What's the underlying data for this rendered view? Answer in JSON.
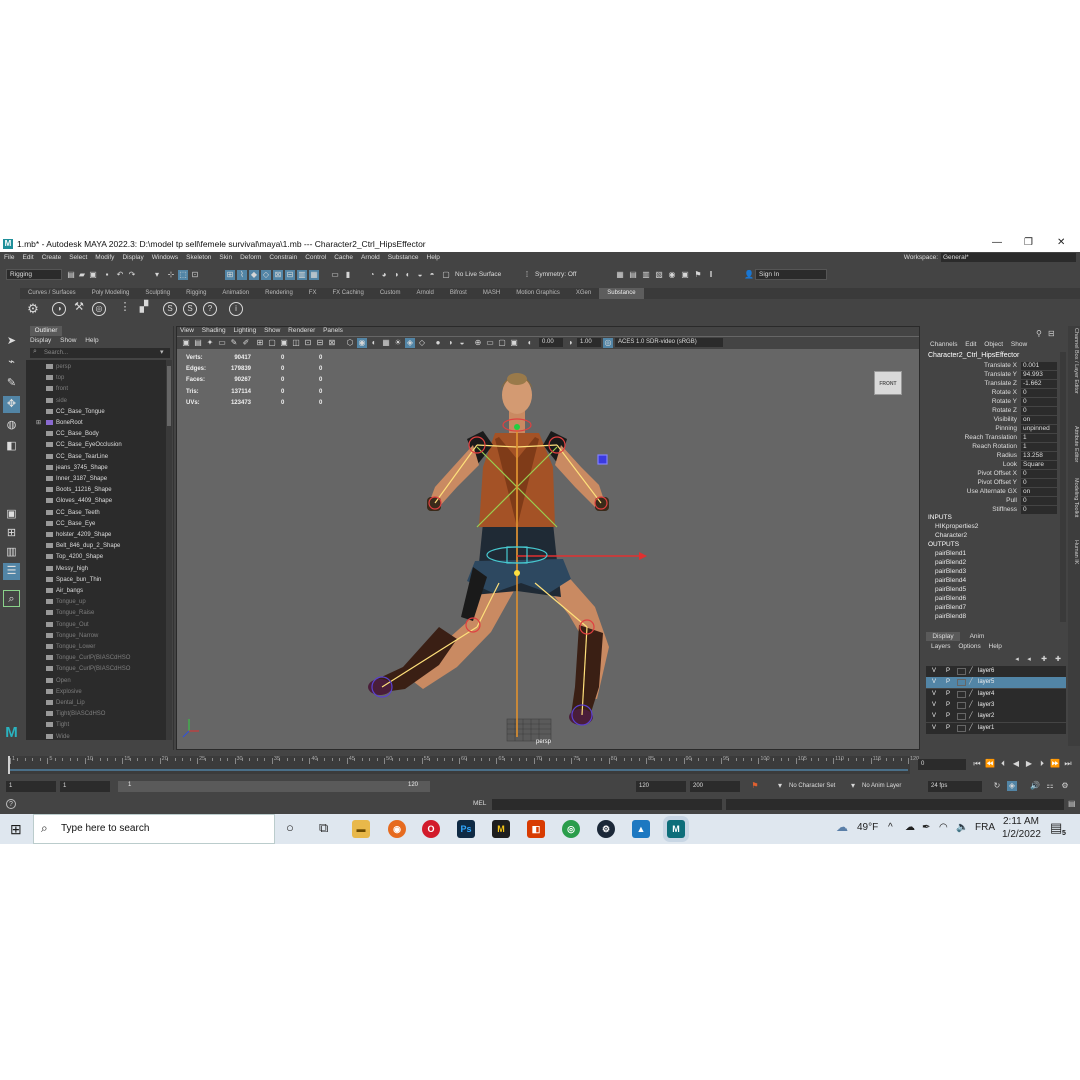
{
  "titlebar": {
    "logo": "M",
    "title": "1.mb* - Autodesk MAYA 2022.3: D:\\model tp sell\\femele survival\\maya\\1.mb   ---   Character2_Ctrl_HipsEffector",
    "controls": [
      "—",
      "❐",
      "✕"
    ]
  },
  "menubar": {
    "items": [
      "File",
      "Edit",
      "Create",
      "Select",
      "Modify",
      "Display",
      "Windows",
      "Skeleton",
      "Skin",
      "Deform",
      "Constrain",
      "Control",
      "Cache",
      "Arnold",
      "Substance",
      "Help"
    ],
    "workspace_label": "Workspace:",
    "workspace_value": "General*"
  },
  "statusline": {
    "menuset": "Rigging",
    "live_surface": "No Live Surface",
    "symmetry": "Symmetry: Off",
    "sign_in": "Sign In"
  },
  "shelf": {
    "tabs": [
      "Curves / Surfaces",
      "Poly Modeling",
      "Sculpting",
      "Rigging",
      "Animation",
      "Rendering",
      "FX",
      "FX Caching",
      "Custom",
      "Arnold",
      "Bifrost",
      "MASH",
      "Motion Graphics",
      "XGen",
      "Substance"
    ],
    "active_tab": "Substance"
  },
  "outliner": {
    "tab": "Outliner",
    "menu": [
      "Display",
      "Show",
      "Help"
    ],
    "search_placeholder": "Search...",
    "items": [
      {
        "label": "persp",
        "dim": true
      },
      {
        "label": "top",
        "dim": true
      },
      {
        "label": "front",
        "dim": true
      },
      {
        "label": "side",
        "dim": true
      },
      {
        "label": "CC_Base_Tongue",
        "dim": false
      },
      {
        "label": "BoneRoot",
        "dim": false,
        "joint": true
      },
      {
        "label": "CC_Base_Body",
        "dim": false
      },
      {
        "label": "CC_Base_EyeOcclusion",
        "dim": false
      },
      {
        "label": "CC_Base_TearLine",
        "dim": false
      },
      {
        "label": "jeans_3745_Shape",
        "dim": false
      },
      {
        "label": "Inner_3187_Shape",
        "dim": false
      },
      {
        "label": "Boots_11216_Shape",
        "dim": false
      },
      {
        "label": "Gloves_4409_Shape",
        "dim": false
      },
      {
        "label": "CC_Base_Teeth",
        "dim": false
      },
      {
        "label": "CC_Base_Eye",
        "dim": false
      },
      {
        "label": "holster_4209_Shape",
        "dim": false
      },
      {
        "label": "Belt_846_dup_2_Shape",
        "dim": false
      },
      {
        "label": "Top_4200_Shape",
        "dim": false
      },
      {
        "label": "Messy_high",
        "dim": false
      },
      {
        "label": "Space_bun_Thin",
        "dim": false
      },
      {
        "label": "Air_bangs",
        "dim": false
      },
      {
        "label": "Tongue_up",
        "dim": true
      },
      {
        "label": "Tongue_Raise",
        "dim": true
      },
      {
        "label": "Tongue_Out",
        "dim": true
      },
      {
        "label": "Tongue_Narrow",
        "dim": true
      },
      {
        "label": "Tongue_Lower",
        "dim": true
      },
      {
        "label": "Tongue_CurlP(BIASCdHSO",
        "dim": true
      },
      {
        "label": "Tongue_CurlP(BIASCdHSO",
        "dim": true
      },
      {
        "label": "Open",
        "dim": true
      },
      {
        "label": "Explosive",
        "dim": true
      },
      {
        "label": "Dental_Lip",
        "dim": true
      },
      {
        "label": "Tight(BIASCdHSO",
        "dim": true
      },
      {
        "label": "Tight",
        "dim": true
      },
      {
        "label": "Wide",
        "dim": true
      }
    ]
  },
  "viewport": {
    "menu": [
      "View",
      "Shading",
      "Lighting",
      "Show",
      "Renderer",
      "Panels"
    ],
    "exposure": "0.00",
    "gamma": "1.00",
    "color_space": "ACES 1.0 SDR-video (sRGB)",
    "hud": [
      {
        "label": "Verts:",
        "v1": "90417",
        "v2": "0",
        "v3": "0"
      },
      {
        "label": "Edges:",
        "v1": "179839",
        "v2": "0",
        "v3": "0"
      },
      {
        "label": "Faces:",
        "v1": "90267",
        "v2": "0",
        "v3": "0"
      },
      {
        "label": "Tris:",
        "v1": "137114",
        "v2": "0",
        "v3": "0"
      },
      {
        "label": "UVs:",
        "v1": "123473",
        "v2": "0",
        "v3": "0"
      }
    ],
    "viewcube_label": "FRONT",
    "camera_label": "persp"
  },
  "channelbox": {
    "menu": [
      "Channels",
      "Edit",
      "Object",
      "Show"
    ],
    "object_name": "Character2_Ctrl_HipsEffector",
    "attributes": [
      {
        "name": "Translate X",
        "value": "0.001"
      },
      {
        "name": "Translate Y",
        "value": "94.993"
      },
      {
        "name": "Translate Z",
        "value": "-1.662"
      },
      {
        "name": "Rotate X",
        "value": "0"
      },
      {
        "name": "Rotate Y",
        "value": "0"
      },
      {
        "name": "Rotate Z",
        "value": "0"
      },
      {
        "name": "Visibility",
        "value": "on"
      },
      {
        "name": "Pinning",
        "value": "unpinned"
      },
      {
        "name": "Reach Translation",
        "value": "1"
      },
      {
        "name": "Reach Rotation",
        "value": "1"
      },
      {
        "name": "Radius",
        "value": "13.258"
      },
      {
        "name": "Look",
        "value": "Square"
      },
      {
        "name": "Pivot Offset X",
        "value": "0"
      },
      {
        "name": "Pivot Offset Y",
        "value": "0"
      },
      {
        "name": "Use Alternate GX",
        "value": "on"
      },
      {
        "name": "Pull",
        "value": "0"
      },
      {
        "name": "Stiffness",
        "value": "0"
      }
    ],
    "inputs_label": "INPUTS",
    "inputs": [
      "HIKproperties2",
      "Character2"
    ],
    "outputs_label": "OUTPUTS",
    "outputs": [
      "pairBlend1",
      "pairBlend2",
      "pairBlend3",
      "pairBlend4",
      "pairBlend5",
      "pairBlend6",
      "pairBlend7",
      "pairBlend8"
    ],
    "side_tabs": [
      "Channel Box / Layer Editor",
      "Attribute Editor",
      "Modeling Toolkit",
      "Human IK"
    ]
  },
  "layers": {
    "tabs": [
      "Display",
      "Anim"
    ],
    "menu": [
      "Layers",
      "Options",
      "Help"
    ],
    "rows": [
      {
        "v": "V",
        "p": "P",
        "name": "layer6",
        "selected": false
      },
      {
        "v": "V",
        "p": "P",
        "name": "layer5",
        "selected": true
      },
      {
        "v": "V",
        "p": "P",
        "name": "layer4",
        "selected": false
      },
      {
        "v": "V",
        "p": "P",
        "name": "layer3",
        "selected": false
      },
      {
        "v": "V",
        "p": "P",
        "name": "layer2",
        "selected": false
      },
      {
        "v": "V",
        "p": "P",
        "name": "layer1",
        "selected": false
      }
    ]
  },
  "timeline": {
    "ticks": [
      "1",
      "5",
      "10",
      "15",
      "20",
      "25",
      "30",
      "35",
      "40",
      "45",
      "50",
      "55",
      "60",
      "65",
      "70",
      "75",
      "80",
      "85",
      "90",
      "95",
      "100",
      "105",
      "110",
      "115",
      "120"
    ],
    "current_frame": "0",
    "range_start": "1",
    "range_start2": "1",
    "slider_start": "1",
    "slider_end": "120",
    "range_end": "120",
    "range_end2": "200",
    "character_set": "No Character Set",
    "anim_layer": "No Anim Layer",
    "fps": "24 fps"
  },
  "commandline": {
    "label": "MEL"
  },
  "taskbar": {
    "search_placeholder": "Type here to search",
    "weather": "49°F",
    "language": "FRA",
    "time": "2:11 AM",
    "date": "1/2/2022",
    "notification_count": "5"
  }
}
